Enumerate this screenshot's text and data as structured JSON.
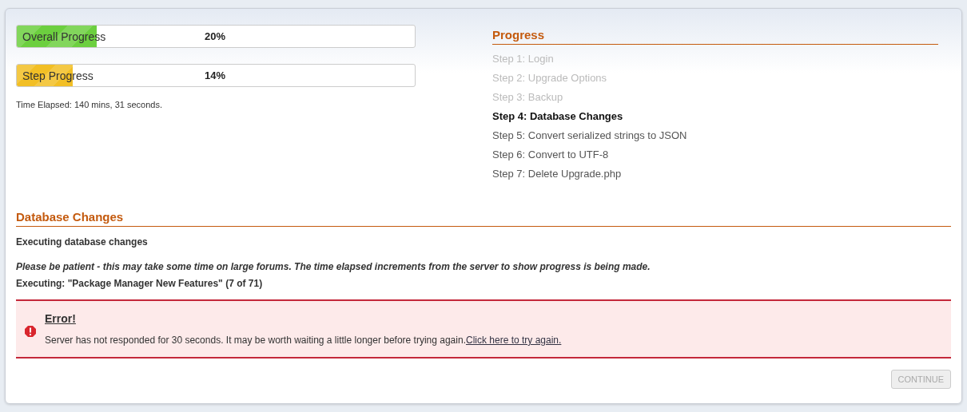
{
  "progress_bars": [
    {
      "label": "Overall Progress",
      "reading": "20%",
      "level": 0.2,
      "color": "#6ccf3f"
    },
    {
      "label": "Step Progress",
      "reading": "14%",
      "level": 0.14,
      "color": "#f2bf25"
    }
  ],
  "time_elapsed": "Time Elapsed: 140 mins, 31 seconds.",
  "progress": {
    "title": "Progress",
    "steps": [
      {
        "label": "Step 1: Login",
        "completed": true,
        "selected": false
      },
      {
        "label": "Step 2: Upgrade Options",
        "completed": true,
        "selected": false
      },
      {
        "label": "Step 3: Backup",
        "completed": true,
        "selected": false
      },
      {
        "label": "Step 4: Database Changes",
        "completed": false,
        "selected": true
      },
      {
        "label": "Step 5: Convert serialized strings to JSON",
        "completed": false,
        "selected": false
      },
      {
        "label": "Step 6: Convert to UTF-8",
        "completed": false,
        "selected": false
      },
      {
        "label": "Step 7: Delete Upgrade.php",
        "completed": false,
        "selected": false
      }
    ]
  },
  "section": {
    "title": "Database Changes",
    "subtitle": "Executing database changes",
    "notice": "Please be patient - this may take some time on large forums. The time elapsed increments from the server to show progress is being made.",
    "executing": "Executing: \"Package Manager New Features\" (7 of 71)"
  },
  "error": {
    "title": "Error!",
    "message": "Server has not responded for 30 seconds. It may be worth waiting a little longer before trying again.",
    "link": "Click here to try again."
  },
  "continue_button": {
    "label": "CONTINUE",
    "disabled": true
  }
}
